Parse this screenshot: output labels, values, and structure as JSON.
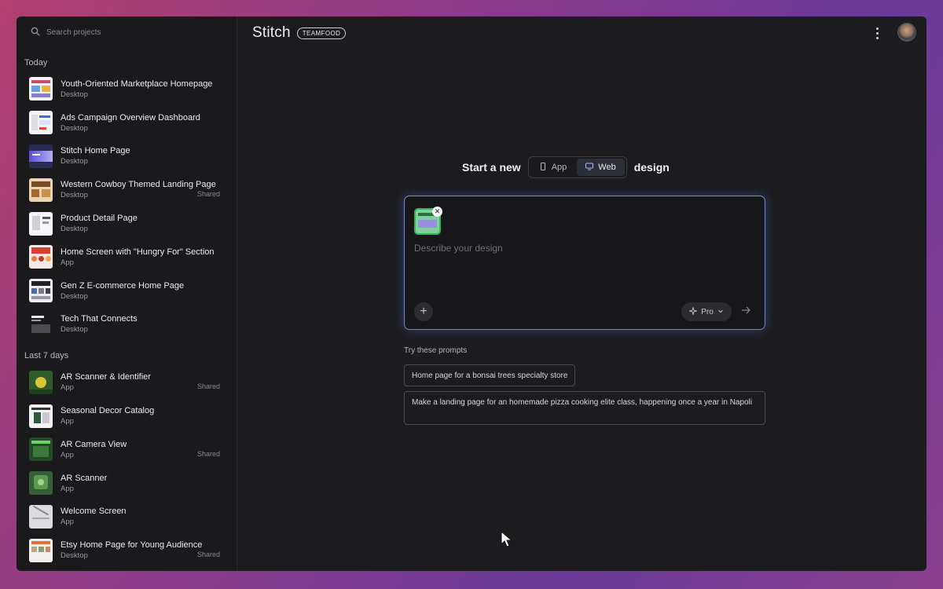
{
  "sidebar": {
    "search_placeholder": "Search projects",
    "sections": [
      {
        "label": "Today",
        "items": [
          {
            "title": "Youth-Oriented Marketplace Homepage",
            "sub": "Desktop",
            "shared": ""
          },
          {
            "title": "Ads Campaign Overview Dashboard",
            "sub": "Desktop",
            "shared": ""
          },
          {
            "title": "Stitch Home Page",
            "sub": "Desktop",
            "shared": ""
          },
          {
            "title": "Western Cowboy Themed Landing Page",
            "sub": "Desktop",
            "shared": "Shared"
          },
          {
            "title": "Product Detail Page",
            "sub": "Desktop",
            "shared": ""
          },
          {
            "title": "Home Screen with \"Hungry For\" Section",
            "sub": "App",
            "shared": ""
          },
          {
            "title": "Gen Z E-commerce Home Page",
            "sub": "Desktop",
            "shared": ""
          },
          {
            "title": "Tech That Connects",
            "sub": "Desktop",
            "shared": ""
          }
        ]
      },
      {
        "label": "Last 7 days",
        "items": [
          {
            "title": "AR Scanner & Identifier",
            "sub": "App",
            "shared": "Shared"
          },
          {
            "title": "Seasonal Decor Catalog",
            "sub": "App",
            "shared": ""
          },
          {
            "title": "AR Camera View",
            "sub": "App",
            "shared": "Shared"
          },
          {
            "title": "AR Scanner",
            "sub": "App",
            "shared": ""
          },
          {
            "title": "Welcome Screen",
            "sub": "App",
            "shared": ""
          },
          {
            "title": "Etsy Home Page for Young Audience",
            "sub": "Desktop",
            "shared": "Shared"
          }
        ]
      }
    ]
  },
  "header": {
    "logo": "Stitch",
    "badge": "TEAMFOOD"
  },
  "main": {
    "headline_prefix": "Start a new",
    "headline_suffix": "design",
    "toggle": {
      "app": "App",
      "web": "Web",
      "selected": "Web"
    },
    "prompt_placeholder": "Describe your design",
    "pro_label": "Pro",
    "try_label": "Try these prompts",
    "prompts": [
      "Home page for a bonsai trees specialty store",
      "Make a landing page for an homemade pizza cooking elite class, happening once a year in Napoli"
    ]
  },
  "colors": {
    "accent_border": "#6f88e8",
    "window_bg": "#1c1c1f",
    "sidebar_bg": "#1a1a1c"
  }
}
